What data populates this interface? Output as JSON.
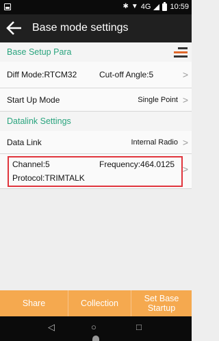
{
  "statusbar": {
    "network": "4G",
    "time": "10:59",
    "icons": [
      "bluetooth-icon",
      "wifi-icon",
      "signal-icon",
      "battery-icon"
    ]
  },
  "appbar": {
    "title": "Base mode settings"
  },
  "sections": {
    "base_setup": {
      "header": "Base Setup Para"
    },
    "datalink": {
      "header": "Datalink Settings"
    }
  },
  "rows": {
    "diff_mode": "Diff Mode:RTCM32",
    "cutoff": "Cut-off Angle:5",
    "startup_label": "Start Up Mode",
    "startup_value": "Single Point",
    "datalink_label": "Data Link",
    "datalink_value": "Internal Radio",
    "channel": "Channel:5",
    "frequency": "Frequency:464.0125",
    "protocol": "Protocol:TRIMTALK"
  },
  "buttons": {
    "share": "Share",
    "collection": "Collection",
    "set_base_line1": "Set Base",
    "set_base_line2": "Startup"
  },
  "colors": {
    "section_text": "#2aa47e",
    "button_bg": "#f5a94f",
    "highlight": "#e0343c",
    "appbar_bg": "#202020"
  }
}
